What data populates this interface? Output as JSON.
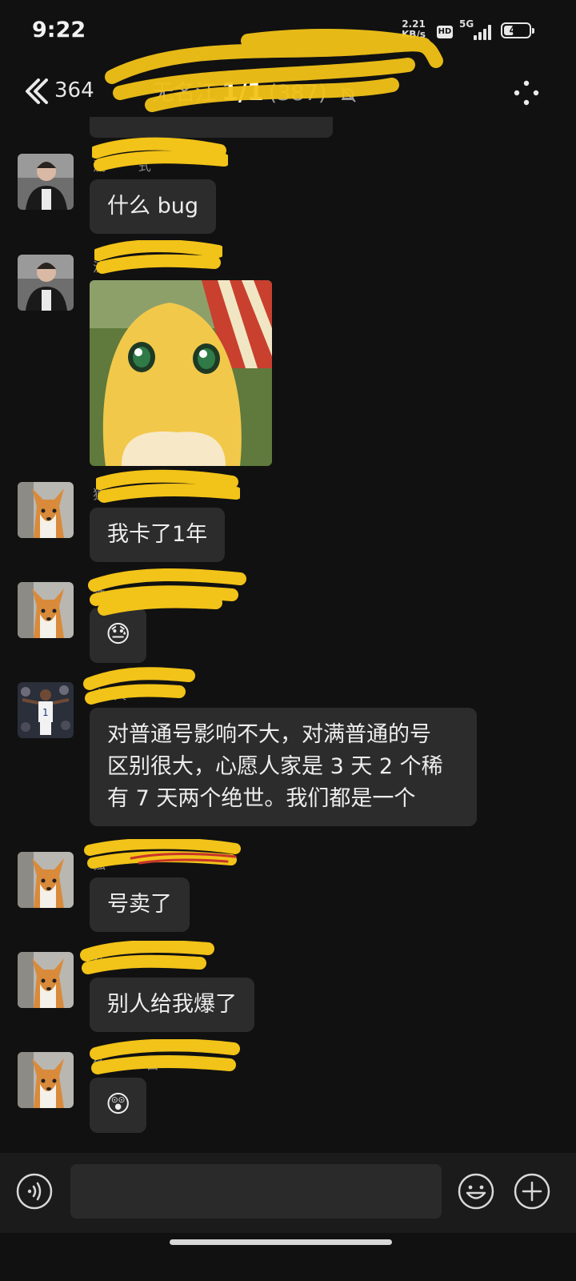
{
  "status": {
    "time": "9:22",
    "speed_value": "2.21",
    "speed_unit": "KB/s",
    "hd": "HD",
    "network": "5G",
    "battery": "40",
    "battery_fraction": 0.4
  },
  "header": {
    "back_count": "364",
    "title_before": "无名江",
    "pager": "1/1",
    "title_after": "(387)",
    "muted_icon": "bell-off-icon",
    "more_icon": "more-dots-icon"
  },
  "messages": [
    {
      "nick": "流",
      "nick_suffix": "式",
      "type": "text",
      "text": "什么 bug",
      "avatar": "man-portrait"
    },
    {
      "nick": "流",
      "type": "image",
      "image": "yellow-cartoon-creature",
      "avatar": "man-portrait"
    },
    {
      "nick": "独",
      "type": "text",
      "text": "我卡了1年",
      "avatar": "corgi"
    },
    {
      "nick": "独",
      "nick_suffix": "白",
      "type": "emoji",
      "emoji": "😓",
      "avatar": "corgi"
    },
    {
      "nick": "小",
      "nick_suffix": "天",
      "type": "text",
      "lines": [
        "对普通号影响不大，对满普通的号",
        "区别很大，心愿人家是 3 天 2 个稀",
        "有 7 天两个绝世。我们都是一个"
      ],
      "avatar": "basketball-player"
    },
    {
      "nick": "独",
      "type": "text",
      "text": "号卖了",
      "avatar": "corgi"
    },
    {
      "nick": "独",
      "type": "text",
      "text": "别人给我爆了",
      "avatar": "corgi"
    },
    {
      "nick": "独",
      "nick_suffix": "白",
      "type": "emoji",
      "emoji": "😲",
      "avatar": "corgi"
    }
  ],
  "input": {
    "value": "",
    "voice_icon": "voice-icon",
    "emoji_icon": "emoji-icon",
    "plus_icon": "plus-icon"
  },
  "colors": {
    "background": "#111111",
    "bubble": "#2c2c2c",
    "redaction": "#f2c318",
    "text": "#ededed"
  }
}
